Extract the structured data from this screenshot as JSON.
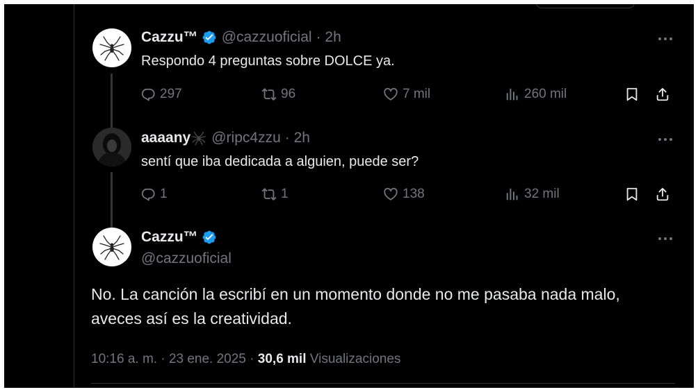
{
  "tweet1": {
    "display_name": "Cazzu™",
    "handle": "@cazzuoficial",
    "time": "· 2h",
    "text": "Respondo 4 preguntas sobre DOLCE ya.",
    "replies": "297",
    "reposts": "96",
    "likes": "7 mil",
    "views": "260 mil"
  },
  "tweet2": {
    "display_name": "aaaany",
    "handle": "@ripc4zzu",
    "time": "· 2h",
    "text": "sentí que iba dedicada a alguien, puede ser?",
    "replies": "1",
    "reposts": "1",
    "likes": "138",
    "views": "32 mil"
  },
  "tweet3": {
    "display_name": "Cazzu™",
    "handle": "@cazzuoficial",
    "text": "No. La canción la escribí en un momento donde no me pasaba nada malo, aveces así es la creatividad.",
    "timestamp": "10:16 a. m. · 23 ene. 2025 ·",
    "views_count": "30,6 mil",
    "views_label": "Visualizaciones"
  },
  "colors": {
    "background": "#000000",
    "text_primary": "#e7e9ea",
    "text_secondary": "#71767b",
    "verified_blue": "#1d9bf0",
    "divider": "#2f3336"
  },
  "icons": [
    "reply-icon",
    "repost-icon",
    "like-icon",
    "views-icon",
    "bookmark-icon",
    "share-icon",
    "more-icon",
    "verified-icon",
    "spider-emoji-icon"
  ]
}
